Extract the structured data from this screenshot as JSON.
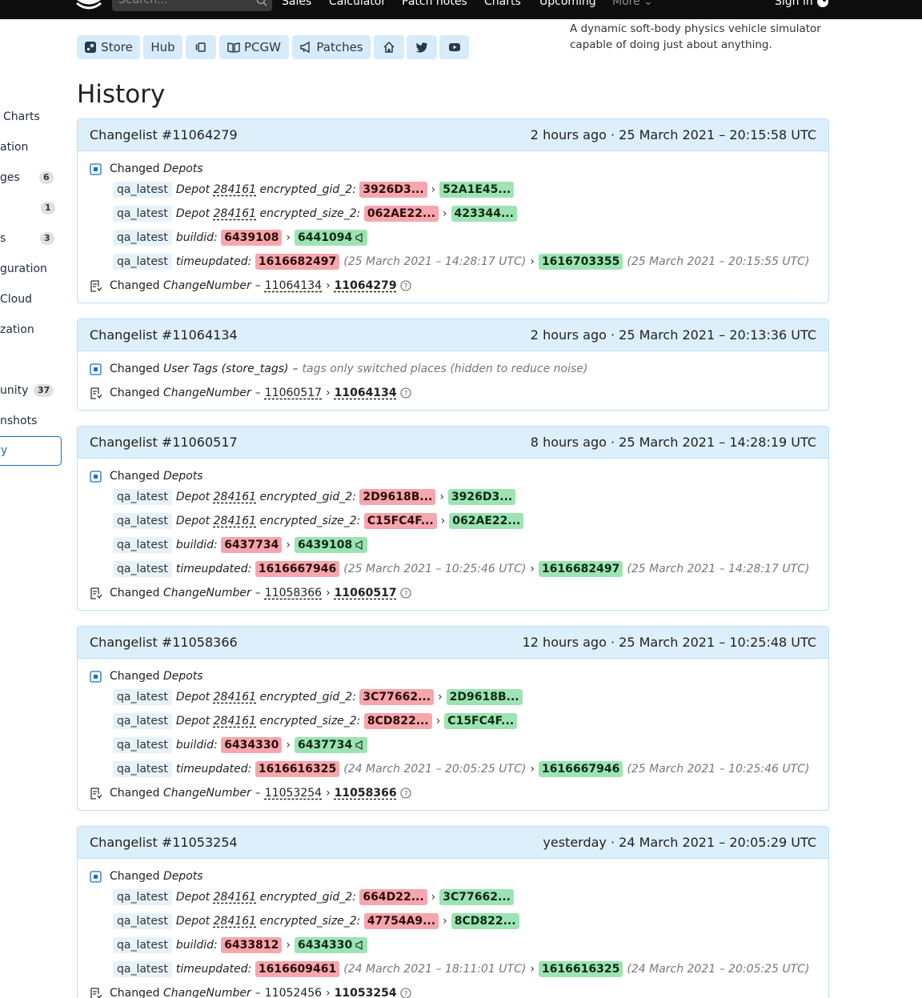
{
  "nav": {
    "search_placeholder": "Search...",
    "items": [
      "Sales",
      "Calculator",
      "Patch notes",
      "Charts",
      "Upcoming",
      "More"
    ],
    "signin": "Sign in"
  },
  "links": {
    "store": "Store",
    "hub": "Hub",
    "pcgw": "PCGW",
    "patches": "Patches"
  },
  "description": "A dynamic soft-body physics vehicle simulator capable of doing just about anything.",
  "sidebar": {
    "items": [
      {
        "label": "Charts",
        "badge": ""
      },
      {
        "label": "ation",
        "badge": ""
      },
      {
        "label": "ges",
        "badge": "6"
      },
      {
        "label": "",
        "badge": "1"
      },
      {
        "label": "s",
        "badge": "3"
      },
      {
        "label": "guration",
        "badge": ""
      },
      {
        "label": "Cloud",
        "badge": ""
      },
      {
        "label": "zation",
        "badge": ""
      },
      {
        "label": "unity",
        "badge": "37"
      },
      {
        "label": "nshots",
        "badge": ""
      }
    ],
    "active": "y"
  },
  "page_title": "History",
  "common": {
    "changed": "Changed",
    "depots": "Depots",
    "branch": "qa_latest",
    "depot": "Depot",
    "depot_id": "284161",
    "gid_key": "encrypted_gid_2:",
    "size_key": "encrypted_size_2:",
    "buildid_key": "buildid:",
    "time_key": "timeupdated:",
    "changenumber": "ChangeNumber",
    "dash": "–",
    "arrow": "›",
    "tags_label": "User Tags (store_tags)",
    "tags_note": "tags only switched places (hidden to reduce noise)"
  },
  "changelists": [
    {
      "title": "Changelist #11064279",
      "time": "2 hours ago · 25 March 2021 – 20:15:58 UTC",
      "gid_old": "3926D3...",
      "gid_new": "52A1E45...",
      "size_old": "062AE22...",
      "size_new": "423344...",
      "build_old": "6439108",
      "build_new": "6441094",
      "time_old": "1616682497",
      "time_old_ts": "(25 March 2021 – 14:28:17 UTC)",
      "time_new": "1616703355",
      "time_new_ts": "(25 March 2021 – 20:15:55 UTC)",
      "cn_old": "11064134",
      "cn_new": "11064279"
    },
    {
      "title": "Changelist #11064134",
      "time": "2 hours ago · 25 March 2021 – 20:13:36 UTC",
      "cn_old": "11060517",
      "cn_new": "11064134"
    },
    {
      "title": "Changelist #11060517",
      "time": "8 hours ago · 25 March 2021 – 14:28:19 UTC",
      "gid_old": "2D9618B...",
      "gid_new": "3926D3...",
      "size_old": "C15FC4F...",
      "size_new": "062AE22...",
      "build_old": "6437734",
      "build_new": "6439108",
      "time_old": "1616667946",
      "time_old_ts": "(25 March 2021 – 10:25:46 UTC)",
      "time_new": "1616682497",
      "time_new_ts": "(25 March 2021 – 14:28:17 UTC)",
      "cn_old": "11058366",
      "cn_new": "11060517"
    },
    {
      "title": "Changelist #11058366",
      "time": "12 hours ago · 25 March 2021 – 10:25:48 UTC",
      "gid_old": "3C77662...",
      "gid_new": "2D9618B...",
      "size_old": "8CD822...",
      "size_new": "C15FC4F...",
      "build_old": "6434330",
      "build_new": "6437734",
      "time_old": "1616616325",
      "time_old_ts": "(24 March 2021 – 20:05:25 UTC)",
      "time_new": "1616667946",
      "time_new_ts": "(25 March 2021 – 10:25:46 UTC)",
      "cn_old": "11053254",
      "cn_new": "11058366"
    },
    {
      "title": "Changelist #11053254",
      "time": "yesterday · 24 March 2021 – 20:05:29 UTC",
      "gid_old": "664D22...",
      "gid_new": "3C77662...",
      "size_old": "47754A9...",
      "size_new": "8CD822...",
      "build_old": "6433812",
      "build_new": "6434330",
      "time_old": "1616609461",
      "time_old_ts": "(24 March 2021 – 18:11:01 UTC)",
      "time_new": "1616616325",
      "time_new_ts": "(24 March 2021 – 20:05:25 UTC)",
      "cn_old": "11052456",
      "cn_new": "11053254"
    }
  ]
}
